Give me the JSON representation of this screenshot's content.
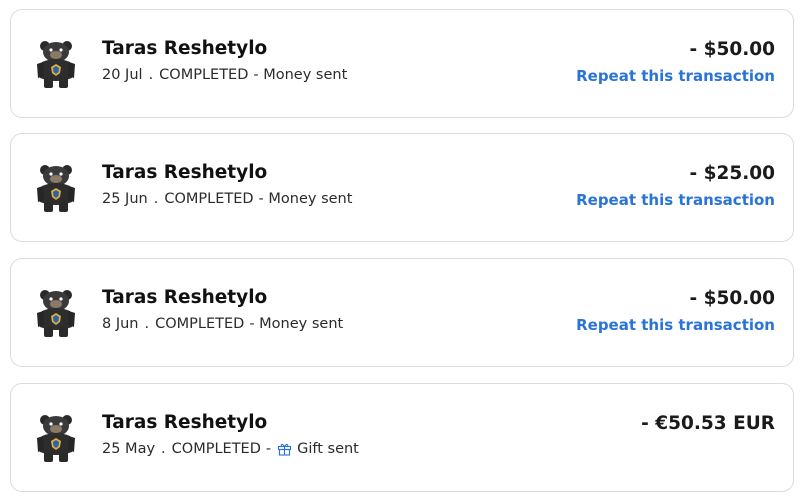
{
  "transactions": [
    {
      "name": "Taras Reshetylo",
      "date": "20 Jul",
      "separator": ".",
      "status": "COMPLETED",
      "type": "- Money sent",
      "amount": "- $50.00",
      "repeat_label": "Repeat this transaction",
      "icon": "bear-avatar-icon"
    },
    {
      "name": "Taras Reshetylo",
      "date": "25 Jun",
      "separator": ".",
      "status": "COMPLETED",
      "type": "- Money sent",
      "amount": "- $25.00",
      "repeat_label": "Repeat this transaction",
      "icon": "bear-avatar-icon"
    },
    {
      "name": "Taras Reshetylo",
      "date": "8 Jun",
      "separator": ".",
      "status": "COMPLETED",
      "type": "- Money sent",
      "amount": "- $50.00",
      "repeat_label": "Repeat this transaction",
      "icon": "bear-avatar-icon"
    },
    {
      "name": "Taras Reshetylo",
      "date": "25 May",
      "separator": ".",
      "status": "COMPLETED",
      "dash": "-",
      "type": "Gift sent",
      "type_icon": "gift-icon",
      "amount": "- €50.53 EUR",
      "icon": "bear-avatar-icon"
    }
  ],
  "colors": {
    "link": "#2a73d9",
    "border": "#dcdcdc",
    "text": "#111111"
  }
}
